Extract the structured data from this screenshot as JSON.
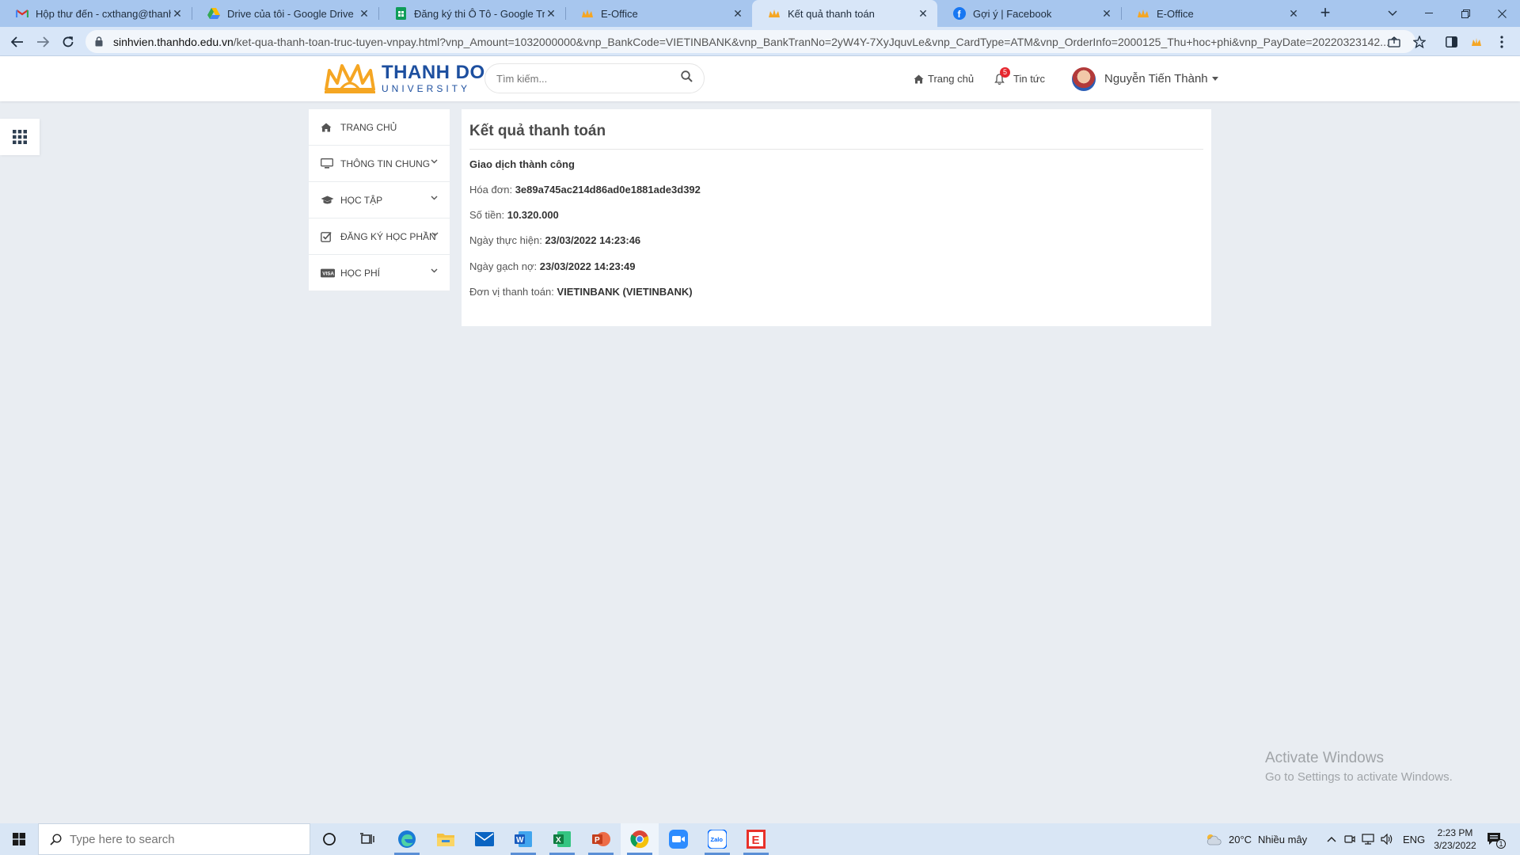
{
  "browser": {
    "tabs": [
      {
        "title": "Hộp thư đến - cxthang@thanhdo",
        "icon": "gmail-icon"
      },
      {
        "title": "Drive của tôi - Google Drive",
        "icon": "google-drive-icon"
      },
      {
        "title": "Đăng ký thi Ô Tô - Google Trang tính",
        "icon": "google-sheets-icon"
      },
      {
        "title": "E-Office",
        "icon": "thanhdo-logo-icon"
      },
      {
        "title": "Kết quả thanh toán",
        "icon": "thanhdo-logo-icon"
      },
      {
        "title": "Gợi ý | Facebook",
        "icon": "facebook-icon"
      },
      {
        "title": "E-Office",
        "icon": "thanhdo-logo-icon"
      }
    ],
    "url_host": "sinhvien.thanhdo.edu.vn",
    "url_path": "/ket-qua-thanh-toan-truc-tuyen-vnpay.html?vnp_Amount=1032000000&vnp_BankCode=VIETINBANK&vnp_BankTranNo=2yW4Y-7XyJquvLe&vnp_CardType=ATM&vnp_OrderInfo=2000125_Thu+hoc+phi&vnp_PayDate=20220323142..."
  },
  "site": {
    "logo_line1": "THANH DO",
    "logo_line2": "UNIVERSITY",
    "search_placeholder": "Tìm kiếm...",
    "nav_home": "Trang chủ",
    "nav_news": "Tin tức",
    "news_badge": "5",
    "user_name": "Nguyễn Tiến Thành"
  },
  "sidebar": {
    "items": [
      {
        "label": "TRANG CHỦ",
        "icon": "home-icon"
      },
      {
        "label": "THÔNG TIN CHUNG",
        "icon": "monitor-icon"
      },
      {
        "label": "HỌC TẬP",
        "icon": "graduation-cap-icon"
      },
      {
        "label": "ĐĂNG KÝ HỌC PHẦN",
        "icon": "checkbox-icon"
      },
      {
        "label": "HỌC PHÍ",
        "icon": "visa-card-icon"
      }
    ]
  },
  "result": {
    "title": "Kết quả thanh toán",
    "status": "Giao dịch thành công",
    "invoice_label": "Hóa đơn:",
    "invoice_value": "3e89a745ac214d86ad0e1881ade3d392",
    "amount_label": "Số tiền:",
    "amount_value": "10.320.000",
    "exec_date_label": "Ngày thực hiện:",
    "exec_date_value": "23/03/2022 14:23:46",
    "debit_date_label": "Ngày gạch nợ:",
    "debit_date_value": "23/03/2022 14:23:49",
    "unit_label": "Đơn vị thanh toán:",
    "unit_value": "VIETINBANK (VIETINBANK)"
  },
  "watermark": {
    "line1": "Activate Windows",
    "line2": "Go to Settings to activate Windows."
  },
  "taskbar": {
    "search_placeholder": "Type here to search",
    "weather_temp": "20°C",
    "weather_text": "Nhiều mây",
    "lang": "ENG",
    "time": "2:23 PM",
    "date": "3/23/2022",
    "notifications": "1"
  }
}
